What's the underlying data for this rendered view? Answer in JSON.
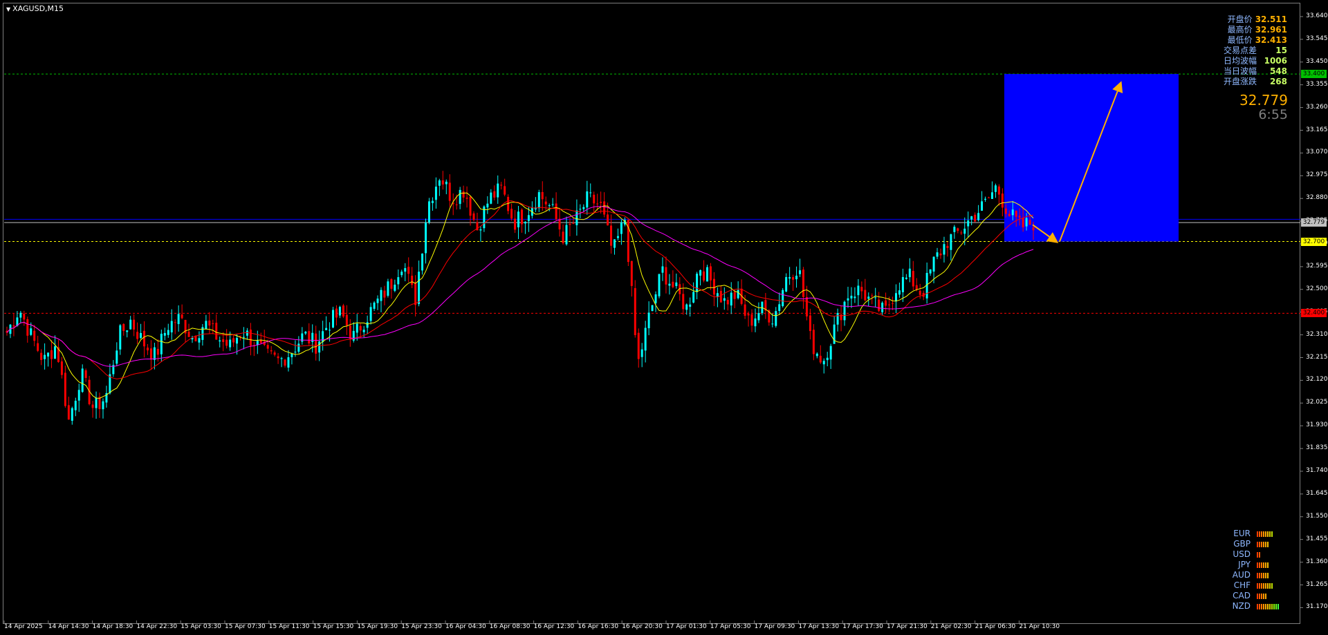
{
  "symbol": "XAGUSD,M15",
  "info_panel": [
    {
      "label": "开盘价",
      "value": "32.511",
      "color": "orange"
    },
    {
      "label": "最高价",
      "value": "32.961",
      "color": "orange"
    },
    {
      "label": "最低价",
      "value": "32.413",
      "color": "orange"
    },
    {
      "label": "交易点差",
      "value": "15",
      "color": "green"
    },
    {
      "label": "日均波幅",
      "value": "1006",
      "color": "green"
    },
    {
      "label": "当日波幅",
      "value": "548",
      "color": "green"
    },
    {
      "label": "开盘涨跌",
      "value": "268",
      "color": "green"
    }
  ],
  "current_price": "32.779",
  "bar_timer": "6:55",
  "price_tags": [
    {
      "name": "target-level-tag",
      "text": "33.400",
      "bg": "#00c000",
      "fg": "#000000"
    },
    {
      "name": "current-price-tag",
      "text": "32.779",
      "bg": "#c0c0c0",
      "fg": "#000000"
    },
    {
      "name": "support-level-tag",
      "text": "32.700",
      "bg": "#ffff00",
      "fg": "#000000"
    },
    {
      "name": "low-level-tag",
      "text": "32.400",
      "bg": "#ff0000",
      "fg": "#000000"
    }
  ],
  "currency_strength": [
    {
      "name": "EUR",
      "bars": 8
    },
    {
      "name": "GBP",
      "bars": 6
    },
    {
      "name": "USD",
      "bars": 2
    },
    {
      "name": "JPY",
      "bars": 6
    },
    {
      "name": "AUD",
      "bars": 6
    },
    {
      "name": "CHF",
      "bars": 8
    },
    {
      "name": "CAD",
      "bars": 5
    },
    {
      "name": "NZD",
      "bars": 11
    }
  ],
  "colors": {
    "bull": "#00ffff",
    "bear": "#ff0000",
    "ma_fast": "#ffff00",
    "ma_mid": "#ff0000",
    "ma_slow": "#ff00ff",
    "target_box": "#0000ff",
    "arrow": "#ffb000",
    "bid_line": "#c0c0c0",
    "ask_line": "#0000ff"
  },
  "chart_data": {
    "type": "candlestick",
    "symbol": "XAGUSD",
    "timeframe": "M15",
    "ylim": [
      31.69,
      33.7
    ],
    "y_ticks": [
      "33.640",
      "33.545",
      "33.450",
      "33.355",
      "33.260",
      "33.165",
      "33.070",
      "32.975",
      "32.880",
      "32.785",
      "32.690",
      "32.595",
      "32.500",
      "32.405",
      "32.310",
      "32.215",
      "32.120",
      "32.025",
      "31.930",
      "31.835",
      "31.740",
      "31.645",
      "31.550",
      "31.455",
      "31.360",
      "31.265",
      "31.170"
    ],
    "x_ticks": [
      "14 Apr 2025",
      "14 Apr 14:30",
      "14 Apr 18:30",
      "14 Apr 22:30",
      "15 Apr 03:30",
      "15 Apr 07:30",
      "15 Apr 11:30",
      "15 Apr 15:30",
      "15 Apr 19:30",
      "15 Apr 23:30",
      "16 Apr 04:30",
      "16 Apr 08:30",
      "16 Apr 12:30",
      "16 Apr 16:30",
      "16 Apr 20:30",
      "17 Apr 01:30",
      "17 Apr 05:30",
      "17 Apr 09:30",
      "17 Apr 13:30",
      "17 Apr 17:30",
      "17 Apr 21:30",
      "21 Apr 02:30",
      "21 Apr 06:30",
      "21 Apr 10:30"
    ],
    "horizontal_levels": [
      {
        "price": 33.4,
        "color": "#00c000",
        "style": "dashed"
      },
      {
        "price": 32.779,
        "color": "#c0c0c0",
        "style": "solid"
      },
      {
        "price": 32.793,
        "color": "#0000ff",
        "style": "solid"
      },
      {
        "price": 32.7,
        "color": "#ffff00",
        "style": "dashed"
      },
      {
        "price": 32.4,
        "color": "#ff0000",
        "style": "dashed"
      }
    ],
    "target_box": {
      "price_top": 33.4,
      "price_bottom": 32.7
    },
    "forecast_arrows": [
      {
        "from_price": 32.77,
        "to_price": 32.7
      },
      {
        "from_price": 32.7,
        "to_price": 33.36
      }
    ],
    "price_path": [
      32.32,
      32.42,
      32.3,
      32.2,
      32.27,
      31.95,
      32.15,
      32.0,
      32.05,
      32.3,
      32.37,
      32.28,
      32.22,
      32.35,
      32.38,
      32.3,
      32.36,
      32.3,
      32.26,
      32.33,
      32.28,
      32.22,
      32.2,
      32.24,
      32.31,
      32.27,
      32.36,
      32.4,
      32.3,
      32.38,
      32.45,
      32.52,
      32.62,
      32.45,
      32.85,
      32.98,
      32.88,
      32.92,
      32.75,
      32.88,
      32.92,
      32.78,
      32.82,
      32.9,
      32.84,
      32.72,
      32.79,
      32.88,
      32.85,
      32.65,
      32.8,
      32.18,
      32.4,
      32.58,
      32.5,
      32.42,
      32.6,
      32.53,
      32.45,
      32.48,
      32.36,
      32.42,
      32.38,
      32.55,
      32.6,
      32.28,
      32.2,
      32.35,
      32.48,
      32.5,
      32.44,
      32.4,
      32.52,
      32.55,
      32.48,
      32.62,
      32.7,
      32.74,
      32.8,
      32.85,
      32.93,
      32.82,
      32.76,
      32.78
    ]
  }
}
